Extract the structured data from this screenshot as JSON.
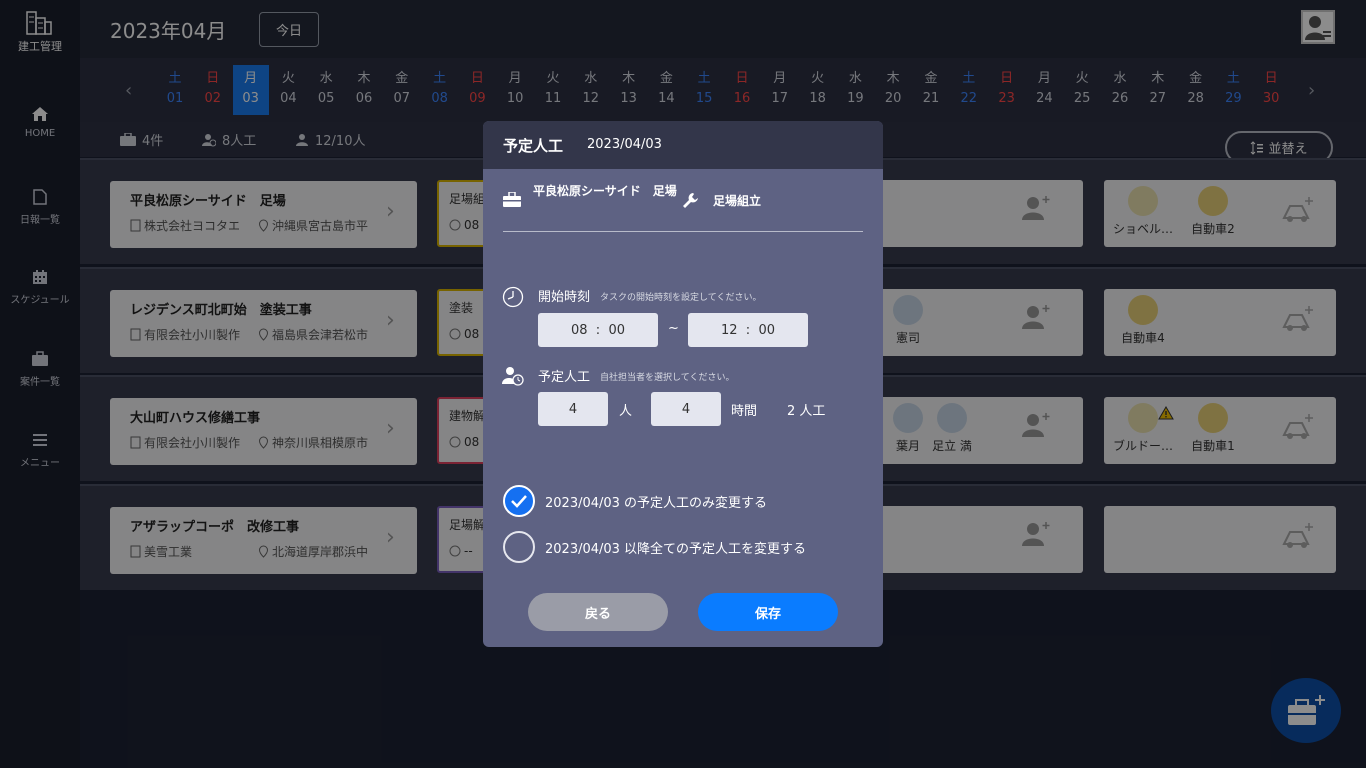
{
  "app": {
    "logo_text": "建工管理"
  },
  "header": {
    "month": "2023年04月",
    "today_label": "今日"
  },
  "sidebar": {
    "items": [
      {
        "label": "HOME",
        "icon": "home-icon"
      },
      {
        "label": "日報一覧",
        "icon": "document-icon"
      },
      {
        "label": "スケジュール",
        "icon": "calendar-icon"
      },
      {
        "label": "案件一覧",
        "icon": "briefcase-icon"
      },
      {
        "label": "メニュー",
        "icon": "menu-icon"
      }
    ]
  },
  "dates": [
    {
      "w": "土",
      "d": "01"
    },
    {
      "w": "日",
      "d": "02"
    },
    {
      "w": "月",
      "d": "03"
    },
    {
      "w": "火",
      "d": "04"
    },
    {
      "w": "水",
      "d": "05"
    },
    {
      "w": "木",
      "d": "06"
    },
    {
      "w": "金",
      "d": "07"
    },
    {
      "w": "土",
      "d": "08"
    },
    {
      "w": "日",
      "d": "09"
    },
    {
      "w": "月",
      "d": "10"
    },
    {
      "w": "火",
      "d": "11"
    },
    {
      "w": "水",
      "d": "12"
    },
    {
      "w": "木",
      "d": "13"
    },
    {
      "w": "金",
      "d": "14"
    },
    {
      "w": "土",
      "d": "15"
    },
    {
      "w": "日",
      "d": "16"
    },
    {
      "w": "月",
      "d": "17"
    },
    {
      "w": "火",
      "d": "18"
    },
    {
      "w": "水",
      "d": "19"
    },
    {
      "w": "木",
      "d": "20"
    },
    {
      "w": "金",
      "d": "21"
    },
    {
      "w": "土",
      "d": "22"
    },
    {
      "w": "日",
      "d": "23"
    },
    {
      "w": "月",
      "d": "24"
    },
    {
      "w": "火",
      "d": "25"
    },
    {
      "w": "水",
      "d": "26"
    },
    {
      "w": "木",
      "d": "27"
    },
    {
      "w": "金",
      "d": "28"
    },
    {
      "w": "土",
      "d": "29"
    },
    {
      "w": "日",
      "d": "30"
    }
  ],
  "summary": {
    "cases": "4件",
    "workers": "8人工",
    "people": "12/10人",
    "sort_label": "並替え"
  },
  "projects": [
    {
      "title": "平良松原シーサイド　足場",
      "company": "株式会社ヨコタエ",
      "location": "沖縄県宮古島市平",
      "task": "足場組立",
      "task_time": "08"
    },
    {
      "title": "レジデンス町北町始　塗装工事",
      "company": "有限会社小川製作",
      "location": "福島県会津若松市",
      "task": "塗装",
      "task_time": "08"
    },
    {
      "title": "大山町ハウス修繕工事",
      "company": "有限会社小川製作",
      "location": "神奈川県相模原市",
      "task": "建物解体",
      "task_time": "08"
    },
    {
      "title": "アザラップコーポ　改修工事",
      "company": "美雪工業",
      "location": "北海道厚岸郡浜中",
      "task": "足場解体",
      "task_time": "--"
    }
  ],
  "mid_people": {
    "row2": [
      "憲司"
    ],
    "row3": [
      "葉月",
      "足立 満"
    ]
  },
  "equipment": {
    "row1": [
      "ショベル…",
      "自動車2"
    ],
    "row2": [
      "自動車4"
    ],
    "row3": [
      "ブルドー…",
      "自動車1"
    ]
  },
  "modal": {
    "title": "予定人工",
    "date": "2023/04/03",
    "project_name": "平良松原シーサイド　足場",
    "work_name": "足場組立",
    "start_label": "開始時刻",
    "start_hint": "タスクの開始時刻を設定してください。",
    "start_h": "08",
    "start_m": "00",
    "end_h": "12",
    "end_m": "00",
    "colon": ":",
    "tilde": "~",
    "workers_label": "予定人工",
    "workers_hint": "自社担当者を選択してください。",
    "people_value": "4",
    "people_unit": "人",
    "hours_value": "4",
    "hours_unit": "時間",
    "total": "2 人工",
    "option1": "2023/04/03 の予定人工のみ変更する",
    "option2": "2023/04/03 以降全ての予定人工を変更する",
    "back_label": "戻る",
    "save_label": "保存"
  },
  "colors": {
    "accent": "#0a7cff",
    "saturday": "#3d86ff",
    "sunday": "#ff4747"
  }
}
